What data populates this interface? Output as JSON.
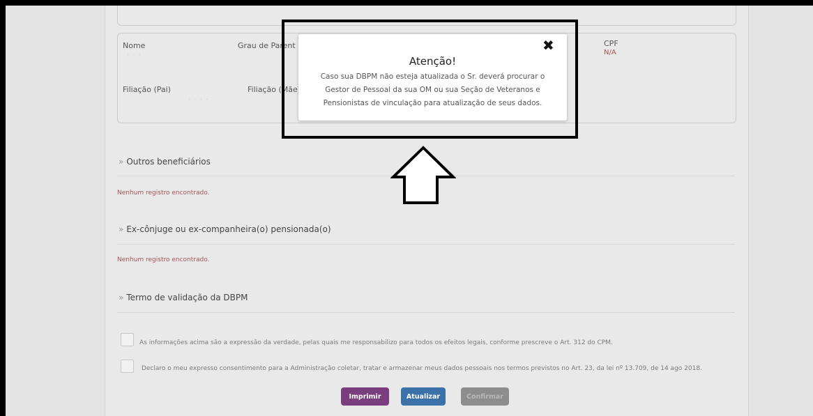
{
  "dependent": {
    "name_label": "Nome",
    "kinship_label": "Grau de Parent",
    "cpf_label": "CPF",
    "cpf_value": "N/A",
    "father_label": "Filiação (Pai)",
    "mother_label": "Filiação (Mãe)"
  },
  "sections": {
    "other_beneficiaries": {
      "title": "Outros beneficiários",
      "empty_message": "Nenhum registro encontrado."
    },
    "ex_spouse": {
      "title": "Ex-cônjuge ou ex-companheira(o) pensionada(o)",
      "empty_message": "Nenhum registro encontrado."
    },
    "validation": {
      "title": "Termo de validação da DBPM"
    }
  },
  "section_marker": "»",
  "checkboxes": [
    {
      "label": "As informações acima são a expressão da verdade, pelas quais me responsabilizo para todos os efeitos legais, conforme prescreve o Art. 312 do CPM.",
      "checked": false
    },
    {
      "label": "Declaro o meu expresso consentimento para a Administração coletar, tratar e armazenar meus dados pessoais nos termos previstos no Art. 23, da lei nº 13.709, de 14 ago 2018.",
      "checked": false
    }
  ],
  "buttons": {
    "print": "Imprimir",
    "update": "Atualizar",
    "confirm": "Confirmar"
  },
  "modal": {
    "close_symbol": "✖",
    "title": "Atenção!",
    "body": "Caso sua DBPM não esteja atualizada o Sr. deverá procurar o Gestor de Pessoal da sua OM ou sua Seção de Veteranos e Pensionistas de vinculação para atualização de seus dados."
  },
  "colors": {
    "print_button": "#7a3d7e",
    "update_button": "#3a71a8",
    "confirm_button": "#8d8d8d",
    "empty_message": "#a05454"
  },
  "icons": [
    "close-icon",
    "up-arrow-icon"
  ]
}
